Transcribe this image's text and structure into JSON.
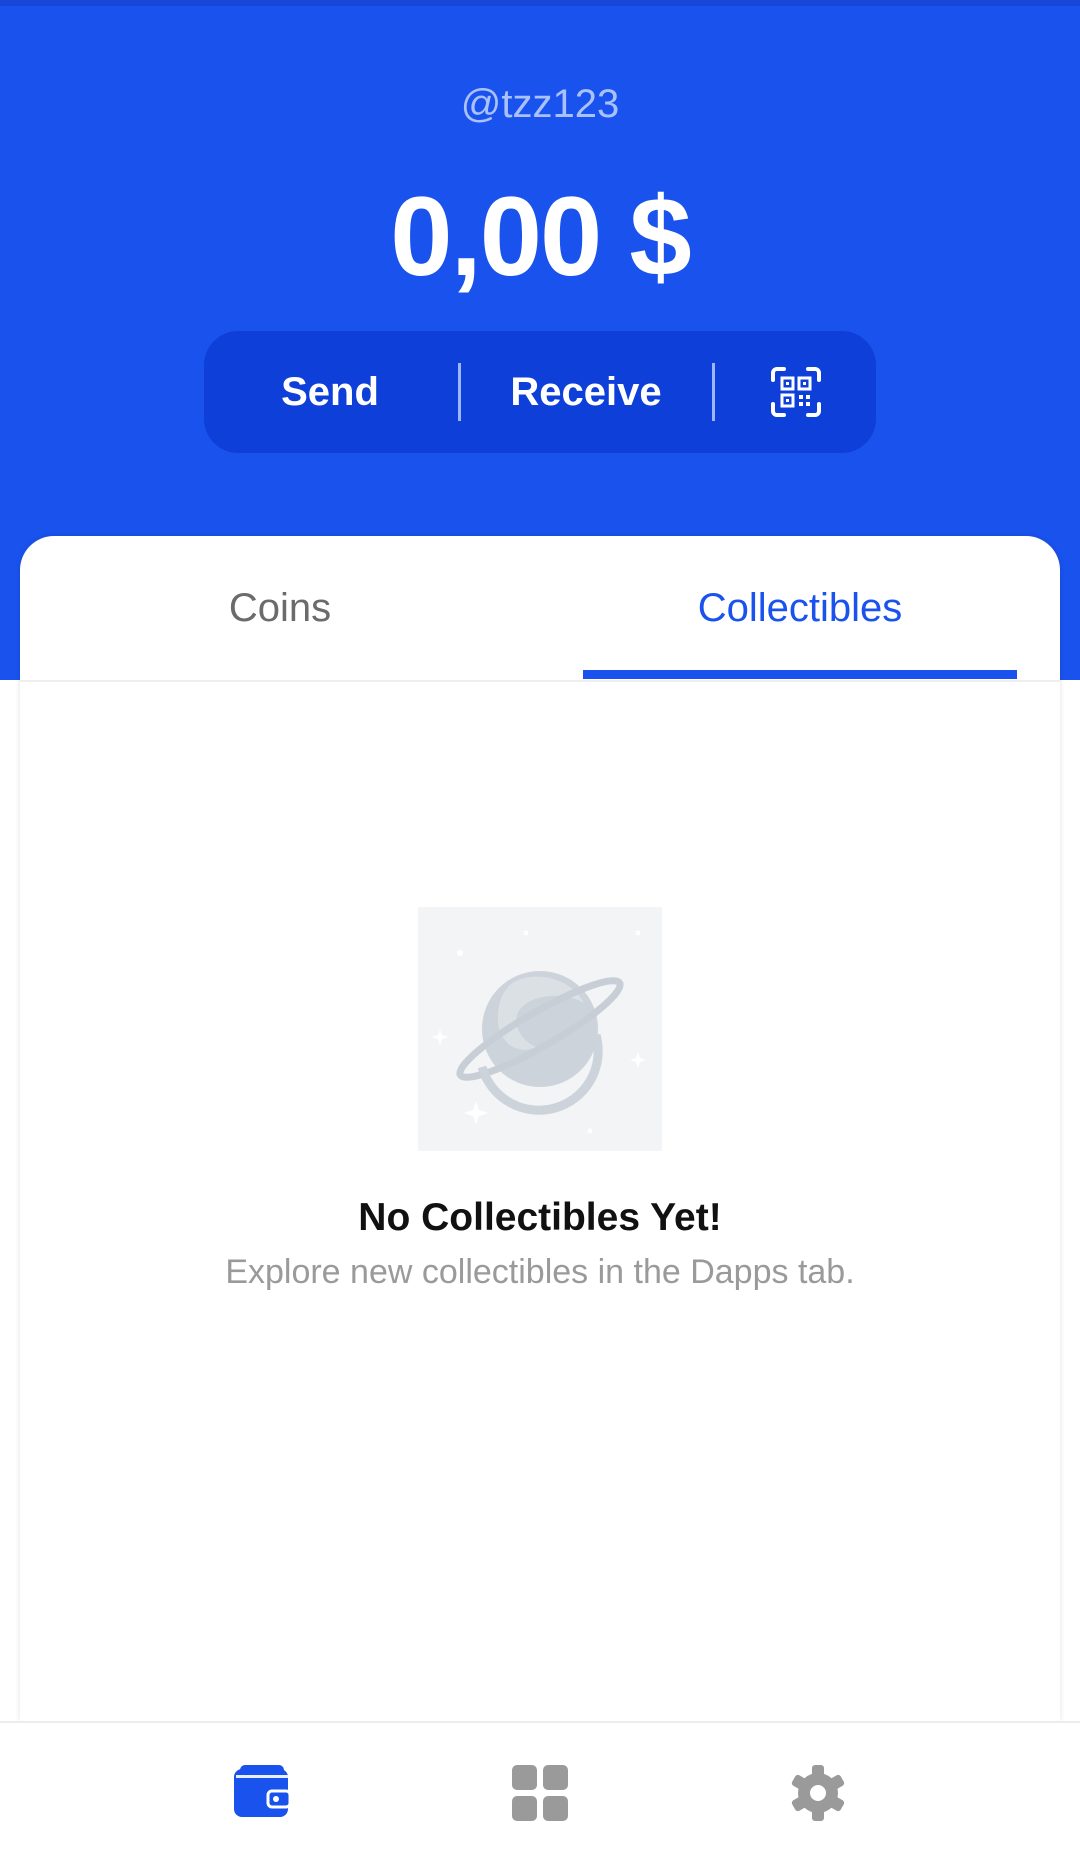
{
  "header": {
    "username": "@tzz123",
    "balance": "0,00 $",
    "actions": {
      "send_label": "Send",
      "receive_label": "Receive",
      "qr_icon": "qr-code-icon"
    }
  },
  "tabs": [
    {
      "label": "Coins",
      "active": false
    },
    {
      "label": "Collectibles",
      "active": true
    }
  ],
  "empty_state": {
    "illustration": "planet-illustration",
    "title": "No Collectibles Yet!",
    "subtitle": "Explore new collectibles in the Dapps tab."
  },
  "bottom_nav": [
    {
      "icon": "wallet-icon",
      "active": true
    },
    {
      "icon": "dapps-grid-icon",
      "active": false
    },
    {
      "icon": "settings-gear-icon",
      "active": false
    }
  ],
  "colors": {
    "brand_blue": "#1a52ee",
    "pill_blue": "#0f3fd9",
    "inactive_gray": "#9a9a9a"
  }
}
